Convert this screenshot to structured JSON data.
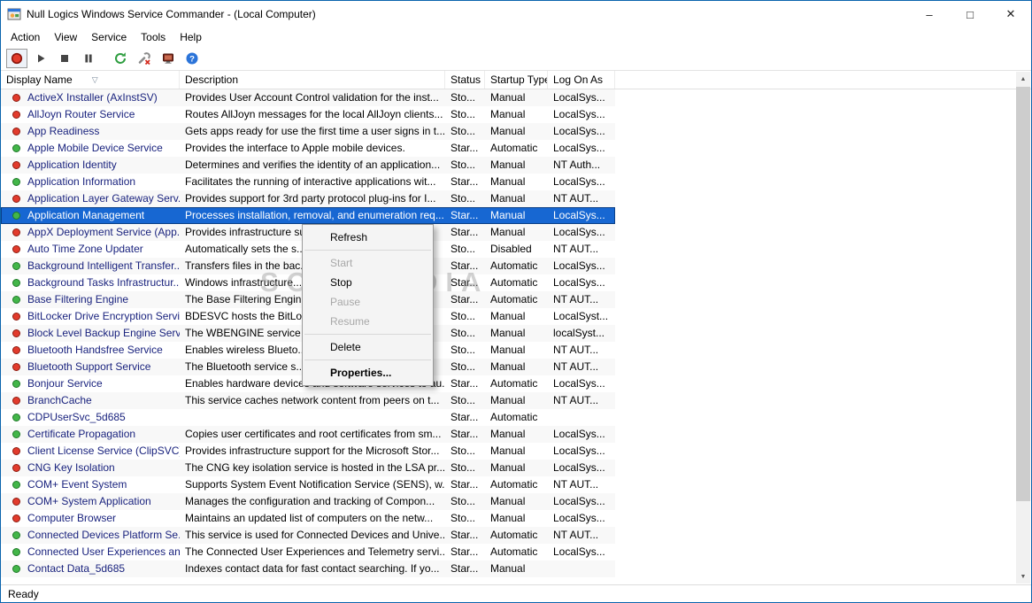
{
  "colors": {
    "window_border": "#0a64ad",
    "selection": "#1767d2",
    "dot_red": "#e23b2c",
    "dot_green": "#43b649",
    "accent": "#0078d7"
  },
  "window": {
    "title": "Null Logics Windows Service Commander - (Local Computer)",
    "controls": {
      "minimize": "–",
      "maximize": "□",
      "close": "✕"
    }
  },
  "menu_bar": {
    "items": [
      "Action",
      "View",
      "Service",
      "Tools",
      "Help"
    ]
  },
  "toolbar": {
    "buttons": [
      "record-icon",
      "play-icon",
      "stop-icon",
      "pause-icon",
      "refresh-icon",
      "repair-icon",
      "computer-icon",
      "help-icon"
    ]
  },
  "table": {
    "sort_indicator": "▽",
    "columns": [
      {
        "label": "Display Name"
      },
      {
        "label": "Description"
      },
      {
        "label": "Status"
      },
      {
        "label": "Startup Type"
      },
      {
        "label": "Log On As"
      }
    ],
    "rows": [
      {
        "dot": "red",
        "name": "ActiveX Installer (AxInstSV)",
        "desc": "Provides User Account Control validation for the inst...",
        "status": "Sto...",
        "startup": "Manual",
        "logon": "LocalSys..."
      },
      {
        "dot": "red",
        "name": "AllJoyn Router Service",
        "desc": "Routes AllJoyn messages for the local AllJoyn clients...",
        "status": "Sto...",
        "startup": "Manual",
        "logon": "LocalSys..."
      },
      {
        "dot": "red",
        "name": "App Readiness",
        "desc": "Gets apps ready for use the first time a user signs in t...",
        "status": "Sto...",
        "startup": "Manual",
        "logon": "LocalSys..."
      },
      {
        "dot": "green",
        "name": "Apple Mobile Device Service",
        "desc": "Provides the interface to Apple mobile devices.",
        "status": "Star...",
        "startup": "Automatic",
        "logon": "LocalSys..."
      },
      {
        "dot": "red",
        "name": "Application Identity",
        "desc": "Determines and verifies the identity of an application...",
        "status": "Sto...",
        "startup": "Manual",
        "logon": "NT Auth..."
      },
      {
        "dot": "green",
        "name": "Application Information",
        "desc": "Facilitates the running of interactive applications wit...",
        "status": "Star...",
        "startup": "Manual",
        "logon": "LocalSys..."
      },
      {
        "dot": "red",
        "name": "Application Layer Gateway Serv...",
        "desc": "Provides support for 3rd party protocol plug-ins for I...",
        "status": "Sto...",
        "startup": "Manual",
        "logon": "NT AUT..."
      },
      {
        "dot": "green",
        "name": "Application Management",
        "desc": "Processes installation, removal, and enumeration req...",
        "status": "Star...",
        "startup": "Manual",
        "logon": "LocalSys...",
        "selected": true
      },
      {
        "dot": "red",
        "name": "AppX Deployment Service (App...",
        "desc": "Provides infrastructure su...",
        "status": "Star...",
        "startup": "Manual",
        "logon": "LocalSys..."
      },
      {
        "dot": "red",
        "name": "Auto Time Zone Updater",
        "desc": "Automatically sets the s...",
        "status": "Sto...",
        "startup": "Disabled",
        "logon": "NT AUT..."
      },
      {
        "dot": "green",
        "name": "Background Intelligent Transfer...",
        "desc": "Transfers files in the bac...",
        "status": "Star...",
        "startup": "Automatic",
        "logon": "LocalSys..."
      },
      {
        "dot": "green",
        "name": "Background Tasks Infrastructur...",
        "desc": "Windows infrastructure...",
        "status": "Star...",
        "startup": "Automatic",
        "logon": "LocalSys..."
      },
      {
        "dot": "green",
        "name": "Base Filtering Engine",
        "desc": "The Base Filtering Engin...",
        "status": "Star...",
        "startup": "Automatic",
        "logon": "NT AUT..."
      },
      {
        "dot": "red",
        "name": "BitLocker Drive Encryption Servi...",
        "desc": "BDESVC hosts the BitLo...",
        "status": "Sto...",
        "startup": "Manual",
        "logon": "LocalSyst..."
      },
      {
        "dot": "red",
        "name": "Block Level Backup Engine Serv...",
        "desc": "The WBENGINE service ...",
        "status": "Sto...",
        "startup": "Manual",
        "logon": "localSyst..."
      },
      {
        "dot": "red",
        "name": "Bluetooth Handsfree Service",
        "desc": "Enables wireless Blueto...",
        "status": "Sto...",
        "startup": "Manual",
        "logon": "NT AUT..."
      },
      {
        "dot": "red",
        "name": "Bluetooth Support Service",
        "desc": "The Bluetooth service s...",
        "status": "Sto...",
        "startup": "Manual",
        "logon": "NT AUT..."
      },
      {
        "dot": "green",
        "name": "Bonjour Service",
        "desc": "Enables hardware devices and software services to au...",
        "status": "Star...",
        "startup": "Automatic",
        "logon": "LocalSys..."
      },
      {
        "dot": "red",
        "name": "BranchCache",
        "desc": "This service caches network content from peers on t...",
        "status": "Sto...",
        "startup": "Manual",
        "logon": "NT AUT..."
      },
      {
        "dot": "green",
        "name": "CDPUserSvc_5d685",
        "desc": "",
        "status": "Star...",
        "startup": "Automatic",
        "logon": ""
      },
      {
        "dot": "green",
        "name": "Certificate Propagation",
        "desc": "Copies user certificates and root certificates from sm...",
        "status": "Star...",
        "startup": "Manual",
        "logon": "LocalSys..."
      },
      {
        "dot": "red",
        "name": "Client License Service (ClipSVC)",
        "desc": "Provides infrastructure support for the Microsoft Stor...",
        "status": "Sto...",
        "startup": "Manual",
        "logon": "LocalSys..."
      },
      {
        "dot": "red",
        "name": "CNG Key Isolation",
        "desc": "The CNG key isolation service is hosted in the LSA pr...",
        "status": "Sto...",
        "startup": "Manual",
        "logon": "LocalSys..."
      },
      {
        "dot": "green",
        "name": "COM+ Event System",
        "desc": "Supports System Event Notification Service (SENS), w...",
        "status": "Star...",
        "startup": "Automatic",
        "logon": "NT AUT..."
      },
      {
        "dot": "red",
        "name": "COM+ System Application",
        "desc": "Manages the configuration and tracking of Compon...",
        "status": "Sto...",
        "startup": "Manual",
        "logon": "LocalSys..."
      },
      {
        "dot": "red",
        "name": "Computer Browser",
        "desc": "Maintains an updated list of computers on the netw...",
        "status": "Sto...",
        "startup": "Manual",
        "logon": "LocalSys..."
      },
      {
        "dot": "green",
        "name": "Connected Devices Platform Se...",
        "desc": "This service is used for Connected Devices and Unive...",
        "status": "Star...",
        "startup": "Automatic",
        "logon": "NT AUT..."
      },
      {
        "dot": "green",
        "name": "Connected User Experiences an...",
        "desc": "The Connected User Experiences and Telemetry servi...",
        "status": "Star...",
        "startup": "Automatic",
        "logon": "LocalSys..."
      },
      {
        "dot": "green",
        "name": "Contact Data_5d685",
        "desc": "Indexes contact data for fast contact searching. If yo...",
        "status": "Star...",
        "startup": "Manual",
        "logon": ""
      }
    ]
  },
  "context_menu": {
    "items": [
      {
        "label": "Refresh",
        "enabled": true
      },
      {
        "separator": true
      },
      {
        "label": "Start",
        "enabled": false
      },
      {
        "label": "Stop",
        "enabled": true
      },
      {
        "label": "Pause",
        "enabled": false
      },
      {
        "label": "Resume",
        "enabled": false
      },
      {
        "separator": true
      },
      {
        "label": "Delete",
        "enabled": true
      },
      {
        "separator": true
      },
      {
        "label": "Properties...",
        "enabled": true,
        "bold": true
      }
    ]
  },
  "watermark": "SOFTPEDIA",
  "status_bar": {
    "text": "Ready"
  }
}
